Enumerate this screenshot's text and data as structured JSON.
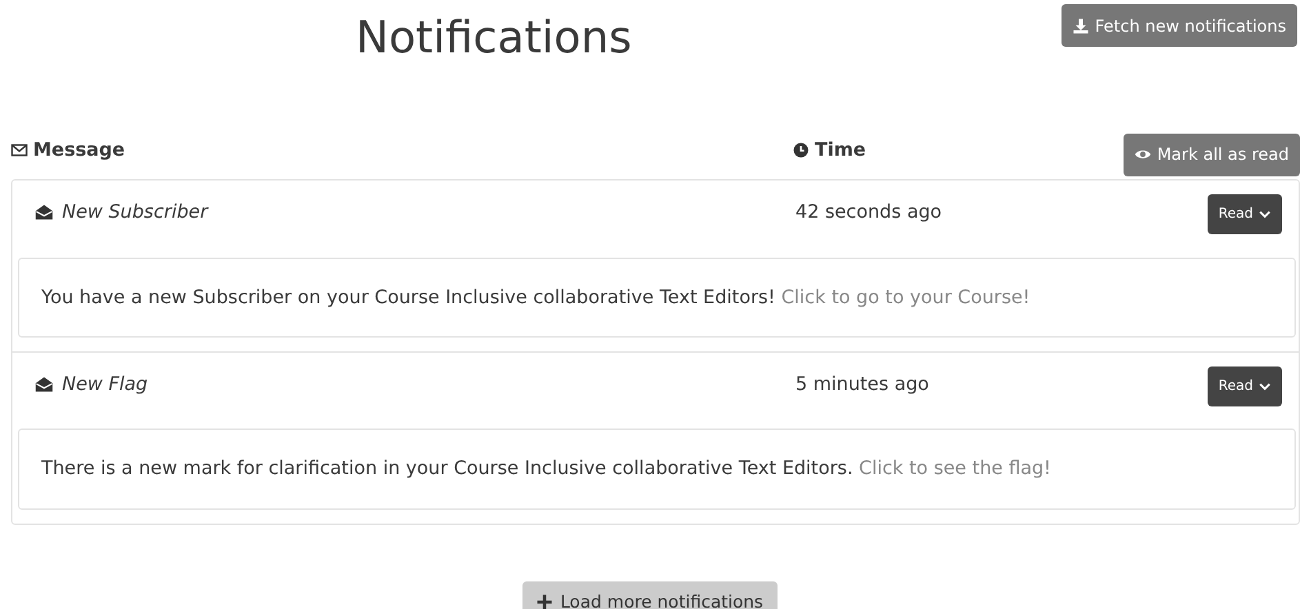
{
  "title": "Notifications",
  "fetch_button": "Fetch new notifications",
  "columns": {
    "message": "Message",
    "time": "Time"
  },
  "mark_all_button": "Mark all as read",
  "notifications": [
    {
      "title": "New Subscriber",
      "time": "42 seconds ago",
      "action": "Read",
      "text": "You have a new Subscriber on your Course Inclusive collaborative Text Editors!",
      "link": "Click to go to your Course!"
    },
    {
      "title": "New Flag",
      "time": "5 minutes ago",
      "action": "Read",
      "text": "There is a new mark for clarification in your Course Inclusive collaborative Text Editors.",
      "link": "Click to see the flag!"
    }
  ],
  "load_more_button": "Load more notifications"
}
